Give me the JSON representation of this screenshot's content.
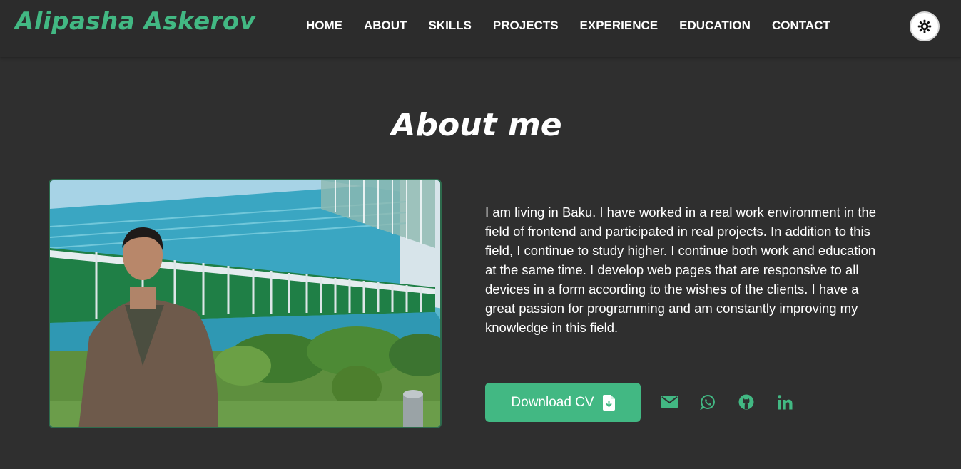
{
  "brand": {
    "name": "Alipasha Askerov",
    "accent_color": "#42b883"
  },
  "nav": {
    "items": [
      {
        "label": "HOME"
      },
      {
        "label": "ABOUT"
      },
      {
        "label": "SKILLS"
      },
      {
        "label": "PROJECTS"
      },
      {
        "label": "EXPERIENCE"
      },
      {
        "label": "EDUCATION"
      },
      {
        "label": "CONTACT"
      }
    ],
    "theme_toggle_icon": "sun-gear-icon"
  },
  "about": {
    "title": "About me",
    "bio": "I am living in Baku. I have worked in a real work environment in the field of frontend and participated in real projects. In addition to this field, I continue to study higher. I continue both work and education at the same time. I develop web pages that are responsive to all devices in a form according to the wishes of the clients. I have a great passion for programming and am constantly improving my knowledge in this field.",
    "download_cv_label": "Download CV",
    "download_icon": "file-download-icon",
    "socials": [
      {
        "name": "email",
        "icon": "envelope-icon"
      },
      {
        "name": "whatsapp",
        "icon": "whatsapp-icon"
      },
      {
        "name": "github",
        "icon": "github-icon"
      },
      {
        "name": "linkedin",
        "icon": "linkedin-icon"
      }
    ]
  }
}
